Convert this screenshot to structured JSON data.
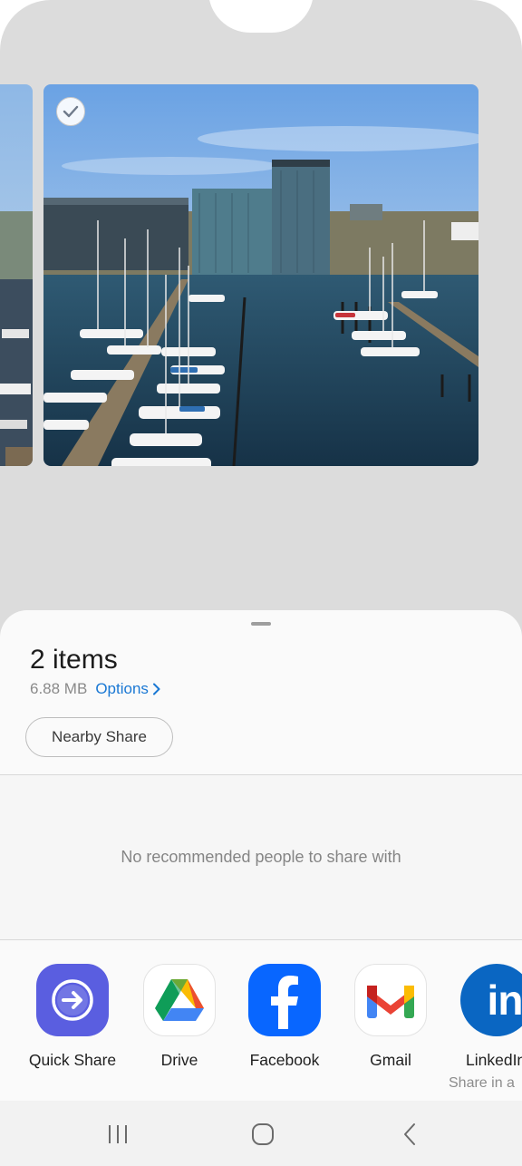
{
  "share": {
    "title": "2 items",
    "size": "6.88 MB",
    "options_label": "Options",
    "nearby_share_label": "Nearby Share",
    "no_people_text": "No recommended people to share with"
  },
  "apps": [
    {
      "label": "Quick Share",
      "icon": "quick-share-icon",
      "sub": ""
    },
    {
      "label": "Drive",
      "icon": "google-drive-icon",
      "sub": ""
    },
    {
      "label": "Facebook",
      "icon": "facebook-icon",
      "sub": ""
    },
    {
      "label": "Gmail",
      "icon": "gmail-icon",
      "sub": ""
    },
    {
      "label": "LinkedIn",
      "icon": "linkedin-icon",
      "sub": "Share in a"
    }
  ],
  "colors": {
    "accent": "#1a78d4",
    "quick_share": "#5a5ee0",
    "facebook": "#0866ff",
    "linkedin": "#0a66c2"
  }
}
